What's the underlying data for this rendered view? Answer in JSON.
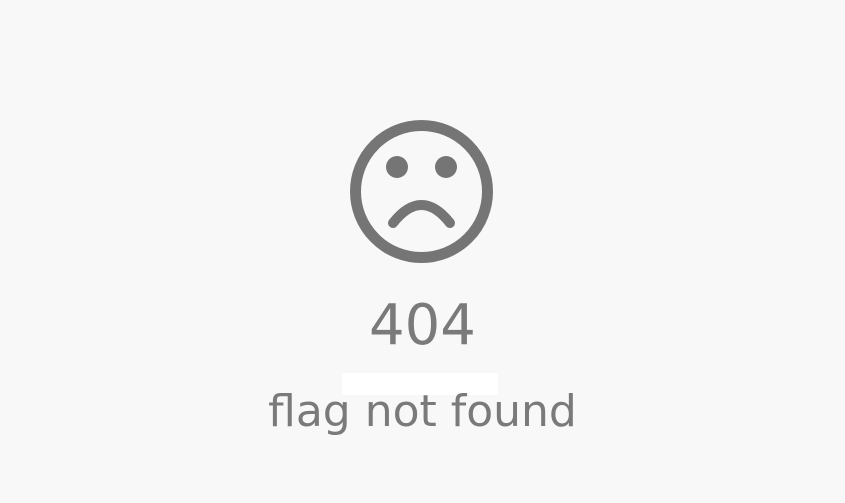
{
  "error": {
    "code": "404",
    "message": "flag not found",
    "icon": "sad-face-icon"
  },
  "colors": {
    "background": "#f8f8f8",
    "text": "#7a7a7a",
    "icon": "#757575"
  }
}
